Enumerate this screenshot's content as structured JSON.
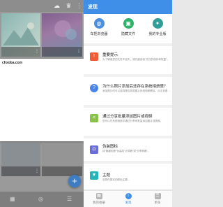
{
  "left": {
    "dialog": {
      "url": "chxoba.com"
    },
    "fab": {
      "label": "+"
    }
  },
  "right": {
    "header": {
      "title": "发现"
    },
    "quick_actions": [
      {
        "label": "车把浏览器",
        "icon": "browser-icon",
        "color": "#4a8fe0",
        "glyph": "◍"
      },
      {
        "label": "隐藏文件",
        "icon": "hidden-file-icon",
        "color": "#2fb36a",
        "glyph": "▣"
      },
      {
        "label": "我的专业版",
        "icon": "pro-icon",
        "color": "#2f9e96",
        "glyph": "✦"
      }
    ],
    "cards": [
      {
        "title": "重要提示",
        "desc": "为了确保您的文件不丢失，请仔细阅读“文件的保存和恢复”。",
        "icon": "warning-icon",
        "color": "#ef5b32",
        "glyph": "!"
      },
      {
        "title": "为什么照片添加后还存在系统相册里？",
        "desc": "添加照片时可以选择是否将原图从系统相册删除。点击查看…",
        "icon": "help-icon",
        "color": "#4a84e8",
        "glyph": "?"
      },
      {
        "title": "通过分享批量添加图片或视频",
        "desc": "您可以在系统相册中通过分享来批量添加图片或视频。",
        "icon": "share-icon",
        "color": "#8bc34a",
        "glyph": "<"
      },
      {
        "title": "伪装图标",
        "desc": "将“隐藏相册”伪装成“计算器”或“分享神器”。",
        "icon": "disguise-icon",
        "color": "#6a6fd8",
        "glyph": "◘"
      },
      {
        "title": "主题",
        "desc": "选择你喜欢的颜色主题…",
        "icon": "theme-icon",
        "color": "#26b5b8",
        "glyph": "▼"
      }
    ],
    "nav": [
      {
        "label": "我的相册",
        "icon": "album-icon",
        "active": false
      },
      {
        "label": "发现",
        "icon": "discover-icon",
        "active": true
      },
      {
        "label": "更多",
        "icon": "more-icon",
        "active": false
      }
    ]
  }
}
